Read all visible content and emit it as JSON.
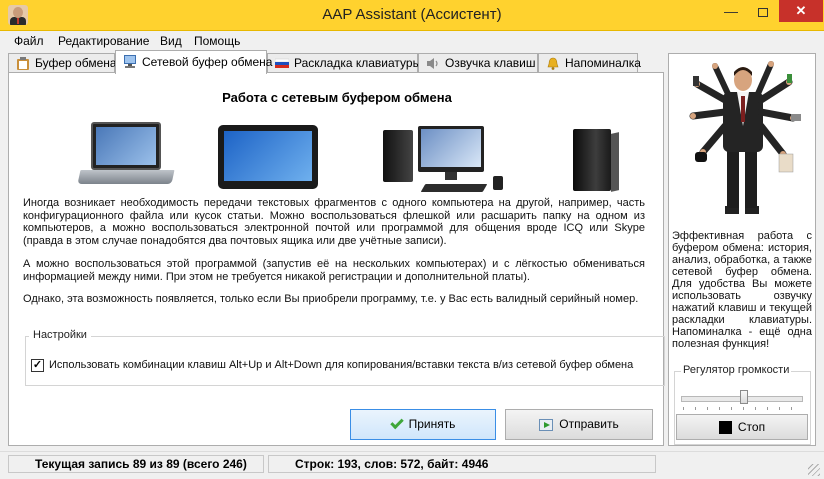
{
  "window": {
    "title": "AAP Assistant (Ассистент)",
    "minimize_glyph": "—",
    "close_glyph": "✕"
  },
  "menu": [
    "Файл",
    "Редактирование",
    "Вид",
    "Помощь"
  ],
  "tabs": [
    {
      "label": "Буфер обмена",
      "icon": "clipboard-icon"
    },
    {
      "label": "Сетевой буфер обмена",
      "icon": "network-computer-icon",
      "active": true
    },
    {
      "label": "Раскладка клавиатуры",
      "icon": "russian-flag-icon"
    },
    {
      "label": "Озвучка клавиш",
      "icon": "speaker-icon"
    },
    {
      "label": "Напоминалка",
      "icon": "bell-icon"
    }
  ],
  "main": {
    "heading": "Работа с сетевым буфером обмена",
    "paragraphs": [
      "Иногда возникает необходимость передачи текстовых фрагментов с одного компьютера на другой, например, часть конфигурационного файла или кусок статьи. Можно воспользоваться флешкой или расшарить папку на одном из компьютеров, а можно воспользоваться электронной почтой или программой для общения вроде ICQ или Skype (правда в этом случае понадобятся два почтовых ящика или две учётные записи).",
      "А можно воспользоваться этой программой (запустив её на нескольких компьютерах) и с лёгкостью обмениваться информацией между ними. При этом не требуется никакой регистрации и дополнительной платы).",
      "Однако, эта возможность появляется, только если Вы приобрели программу, т.е. у Вас есть валидный серийный номер."
    ],
    "illustrations": [
      "laptop-icon",
      "tablet-icon",
      "desktop-computer-icon",
      "server-tower-icon"
    ],
    "settings": {
      "legend": "Настройки",
      "checkbox_checked": true,
      "checkbox_mark": "✓",
      "checkbox_label": "Использовать комбинации клавиш Alt+Up и Alt+Down для копирования/вставки текста в/из сетевой буфер обмена"
    },
    "accept_label": "Принять",
    "send_label": "Отправить"
  },
  "side": {
    "text": "Эффективная работа с буфером обмена: история, анализ, обработка, а также сетевой буфер обмена. Для удобства Вы можете использовать озвучку нажатий клавиш и текущей раскладки клавиатуры. Напоминалка - ещё одна полезная функция!",
    "volume": {
      "legend": "Регулятор громкости",
      "level": 0.52
    },
    "stop_label": "Стоп"
  },
  "status": {
    "record": "Текущая запись 89 из 89 (всего 246)",
    "stats": "Строк: 193, слов: 572, байт: 4946"
  },
  "colors": {
    "titlebar": "#ffd22e",
    "close_button": "#c7312a",
    "accept_border": "#3a8ee6",
    "check_green": "#3fa73a"
  }
}
